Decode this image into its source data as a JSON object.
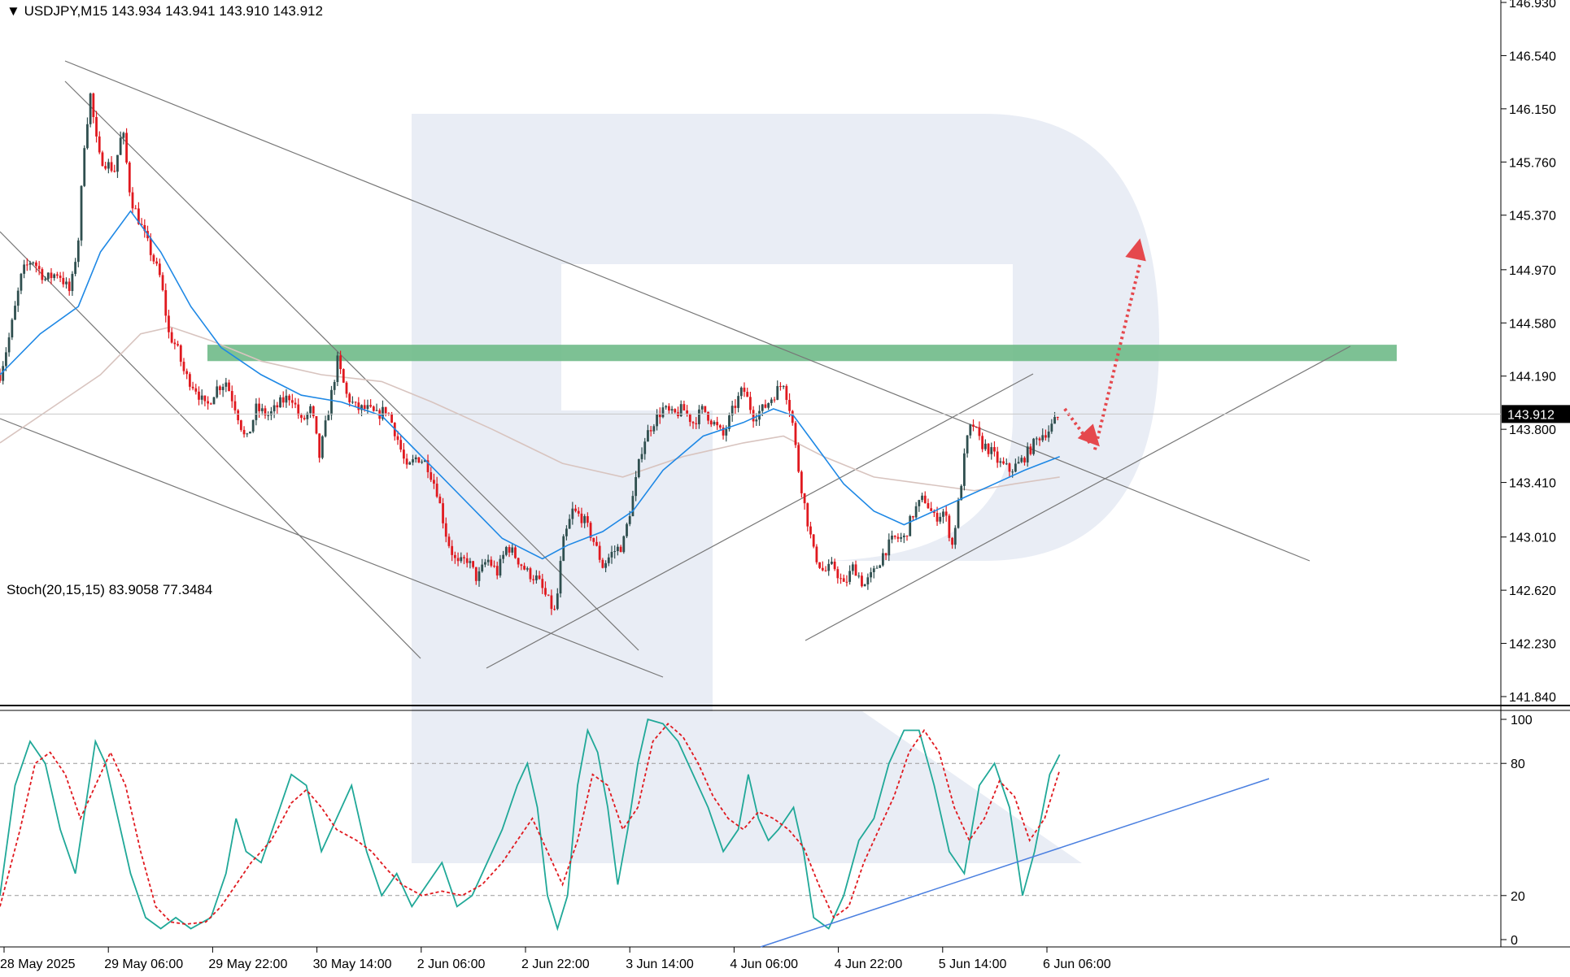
{
  "header": {
    "symbol": "USDJPY,M15",
    "ohlc": "143.934 143.941 143.910 143.912",
    "indicator": "Stoch(20,15,15) 83.9058 77.3484"
  },
  "price_axis": {
    "ticks": [
      "146.930",
      "146.540",
      "146.150",
      "145.760",
      "145.370",
      "144.970",
      "144.580",
      "144.190",
      "143.800",
      "143.410",
      "143.010",
      "142.620",
      "142.230",
      "141.840"
    ],
    "current_price": "143.912"
  },
  "stoch_axis": {
    "ticks": [
      "100",
      "80",
      "20",
      "0"
    ]
  },
  "time_axis": {
    "labels": [
      "28 May 2025",
      "29 May 06:00",
      "29 May 22:00",
      "30 May 14:00",
      "2 Jun 06:00",
      "2 Jun 22:00",
      "3 Jun 14:00",
      "4 Jun 06:00",
      "4 Jun 22:00",
      "5 Jun 14:00",
      "6 Jun 06:00"
    ]
  },
  "colors": {
    "bull": "#2f4f4f",
    "bear": "#e0191f",
    "ma_fast": "#1e88e5",
    "ma_slow": "#d8c4bf",
    "zone": "#6fba88",
    "arrow": "#e5484d",
    "stoch_main": "#20a898",
    "stoch_signal": "#e0191f",
    "trend": "#777777",
    "stoch_trend": "#4a7fe0"
  },
  "chart_data": [
    {
      "type": "candlestick",
      "symbol": "USDJPY",
      "timeframe": "M15",
      "ylim": [
        141.84,
        146.93
      ],
      "resistance_zone": [
        144.3,
        144.42
      ],
      "current_price": 143.912,
      "x_labels": [
        "28 May 2025",
        "29 May 06:00",
        "29 May 22:00",
        "30 May 14:00",
        "2 Jun 06:00",
        "2 Jun 22:00",
        "3 Jun 14:00",
        "4 Jun 06:00",
        "4 Jun 22:00",
        "5 Jun 14:00",
        "6 Jun 06:00"
      ],
      "path": [
        [
          0,
          144.2
        ],
        [
          10,
          144.5
        ],
        [
          22,
          144.95
        ],
        [
          32,
          145.05
        ],
        [
          45,
          144.9
        ],
        [
          58,
          144.95
        ],
        [
          70,
          144.8
        ],
        [
          78,
          145.2
        ],
        [
          84,
          145.9
        ],
        [
          90,
          146.25
        ],
        [
          98,
          145.8
        ],
        [
          106,
          145.75
        ],
        [
          114,
          145.7
        ],
        [
          122,
          146.0
        ],
        [
          130,
          145.5
        ],
        [
          140,
          145.3
        ],
        [
          150,
          145.1
        ],
        [
          160,
          144.9
        ],
        [
          168,
          144.5
        ],
        [
          176,
          144.4
        ],
        [
          184,
          144.2
        ],
        [
          195,
          144.1
        ],
        [
          205,
          143.95
        ],
        [
          215,
          144.1
        ],
        [
          225,
          144.15
        ],
        [
          235,
          143.95
        ],
        [
          245,
          143.7
        ],
        [
          255,
          143.95
        ],
        [
          268,
          143.9
        ],
        [
          280,
          144.0
        ],
        [
          290,
          144.05
        ],
        [
          300,
          143.85
        ],
        [
          310,
          143.95
        ],
        [
          318,
          143.6
        ],
        [
          326,
          143.9
        ],
        [
          336,
          144.3
        ],
        [
          345,
          144.05
        ],
        [
          355,
          143.95
        ],
        [
          365,
          143.95
        ],
        [
          375,
          143.9
        ],
        [
          385,
          143.95
        ],
        [
          395,
          143.75
        ],
        [
          405,
          143.5
        ],
        [
          415,
          143.6
        ],
        [
          425,
          143.55
        ],
        [
          435,
          143.35
        ],
        [
          445,
          143.0
        ],
        [
          455,
          142.8
        ],
        [
          465,
          142.85
        ],
        [
          475,
          142.7
        ],
        [
          485,
          142.85
        ],
        [
          495,
          142.75
        ],
        [
          505,
          142.95
        ],
        [
          515,
          142.85
        ],
        [
          525,
          142.75
        ],
        [
          535,
          142.7
        ],
        [
          545,
          142.55
        ],
        [
          553,
          142.45
        ],
        [
          560,
          142.95
        ],
        [
          570,
          143.2
        ],
        [
          580,
          143.15
        ],
        [
          590,
          143.0
        ],
        [
          600,
          142.8
        ],
        [
          610,
          142.9
        ],
        [
          620,
          142.95
        ],
        [
          630,
          143.3
        ],
        [
          640,
          143.7
        ],
        [
          650,
          143.85
        ],
        [
          660,
          143.95
        ],
        [
          670,
          143.9
        ],
        [
          680,
          143.95
        ],
        [
          690,
          143.85
        ],
        [
          700,
          143.95
        ],
        [
          710,
          143.85
        ],
        [
          720,
          143.75
        ],
        [
          730,
          143.95
        ],
        [
          740,
          144.1
        ],
        [
          750,
          143.9
        ],
        [
          760,
          143.95
        ],
        [
          770,
          144.05
        ],
        [
          780,
          144.15
        ],
        [
          788,
          143.9
        ],
        [
          794,
          143.55
        ],
        [
          802,
          143.2
        ],
        [
          810,
          142.9
        ],
        [
          820,
          142.75
        ],
        [
          830,
          142.8
        ],
        [
          840,
          142.65
        ],
        [
          850,
          142.8
        ],
        [
          860,
          142.65
        ],
        [
          870,
          142.75
        ],
        [
          880,
          142.9
        ],
        [
          890,
          143.0
        ],
        [
          900,
          143.0
        ],
        [
          910,
          143.2
        ],
        [
          920,
          143.3
        ],
        [
          930,
          143.15
        ],
        [
          940,
          143.2
        ],
        [
          948,
          142.95
        ],
        [
          955,
          143.3
        ],
        [
          962,
          143.7
        ],
        [
          968,
          143.85
        ],
        [
          976,
          143.7
        ],
        [
          985,
          143.65
        ],
        [
          995,
          143.55
        ],
        [
          1005,
          143.5
        ],
        [
          1015,
          143.55
        ],
        [
          1025,
          143.65
        ],
        [
          1035,
          143.75
        ],
        [
          1045,
          143.8
        ],
        [
          1055,
          143.91
        ]
      ],
      "ma_fast": [
        [
          0,
          144.2
        ],
        [
          40,
          144.5
        ],
        [
          78,
          144.7
        ],
        [
          100,
          145.1
        ],
        [
          130,
          145.4
        ],
        [
          160,
          145.1
        ],
        [
          190,
          144.7
        ],
        [
          220,
          144.4
        ],
        [
          260,
          144.2
        ],
        [
          300,
          144.05
        ],
        [
          340,
          144.0
        ],
        [
          380,
          143.9
        ],
        [
          420,
          143.6
        ],
        [
          460,
          143.3
        ],
        [
          500,
          143.0
        ],
        [
          540,
          142.85
        ],
        [
          565,
          142.95
        ],
        [
          600,
          143.05
        ],
        [
          630,
          143.2
        ],
        [
          660,
          143.5
        ],
        [
          700,
          143.75
        ],
        [
          740,
          143.85
        ],
        [
          770,
          143.95
        ],
        [
          790,
          143.9
        ],
        [
          810,
          143.7
        ],
        [
          840,
          143.4
        ],
        [
          870,
          143.2
        ],
        [
          900,
          143.1
        ],
        [
          930,
          143.2
        ],
        [
          960,
          143.3
        ],
        [
          990,
          143.4
        ],
        [
          1020,
          143.5
        ],
        [
          1055,
          143.6
        ]
      ],
      "ma_slow": [
        [
          0,
          143.7
        ],
        [
          50,
          143.95
        ],
        [
          100,
          144.2
        ],
        [
          140,
          144.5
        ],
        [
          170,
          144.55
        ],
        [
          210,
          144.45
        ],
        [
          260,
          144.3
        ],
        [
          320,
          144.2
        ],
        [
          380,
          144.15
        ],
        [
          430,
          144.0
        ],
        [
          490,
          143.8
        ],
        [
          560,
          143.55
        ],
        [
          620,
          143.45
        ],
        [
          680,
          143.6
        ],
        [
          740,
          143.7
        ],
        [
          780,
          143.75
        ],
        [
          820,
          143.6
        ],
        [
          870,
          143.45
        ],
        [
          920,
          143.4
        ],
        [
          970,
          143.35
        ],
        [
          1010,
          143.4
        ],
        [
          1055,
          143.45
        ]
      ],
      "forecast": [
        [
          1060,
          143.95
        ],
        [
          1090,
          143.65
        ],
        [
          1135,
          145.2
        ]
      ]
    },
    {
      "type": "line",
      "title": "Stoch(20,15,15)",
      "main": 83.9058,
      "signal": 77.3484,
      "levels": [
        80,
        20
      ],
      "ylim": [
        0,
        100
      ],
      "main_path": [
        [
          0,
          20
        ],
        [
          15,
          70
        ],
        [
          30,
          90
        ],
        [
          45,
          80
        ],
        [
          60,
          50
        ],
        [
          75,
          30
        ],
        [
          85,
          60
        ],
        [
          95,
          90
        ],
        [
          105,
          80
        ],
        [
          115,
          60
        ],
        [
          130,
          30
        ],
        [
          145,
          10
        ],
        [
          160,
          5
        ],
        [
          175,
          10
        ],
        [
          190,
          5
        ],
        [
          210,
          10
        ],
        [
          225,
          30
        ],
        [
          235,
          55
        ],
        [
          245,
          40
        ],
        [
          260,
          35
        ],
        [
          275,
          55
        ],
        [
          290,
          75
        ],
        [
          305,
          70
        ],
        [
          320,
          40
        ],
        [
          335,
          55
        ],
        [
          350,
          70
        ],
        [
          365,
          40
        ],
        [
          380,
          20
        ],
        [
          395,
          30
        ],
        [
          410,
          15
        ],
        [
          425,
          25
        ],
        [
          440,
          35
        ],
        [
          455,
          15
        ],
        [
          470,
          20
        ],
        [
          485,
          35
        ],
        [
          500,
          50
        ],
        [
          515,
          70
        ],
        [
          525,
          80
        ],
        [
          535,
          60
        ],
        [
          545,
          20
        ],
        [
          555,
          5
        ],
        [
          565,
          20
        ],
        [
          575,
          70
        ],
        [
          585,
          95
        ],
        [
          595,
          85
        ],
        [
          605,
          60
        ],
        [
          615,
          25
        ],
        [
          625,
          50
        ],
        [
          635,
          80
        ],
        [
          645,
          100
        ],
        [
          660,
          98
        ],
        [
          675,
          90
        ],
        [
          690,
          75
        ],
        [
          705,
          60
        ],
        [
          720,
          40
        ],
        [
          735,
          50
        ],
        [
          745,
          75
        ],
        [
          755,
          55
        ],
        [
          765,
          45
        ],
        [
          775,
          50
        ],
        [
          790,
          60
        ],
        [
          800,
          40
        ],
        [
          810,
          10
        ],
        [
          825,
          5
        ],
        [
          840,
          20
        ],
        [
          855,
          45
        ],
        [
          870,
          55
        ],
        [
          885,
          80
        ],
        [
          900,
          95
        ],
        [
          915,
          95
        ],
        [
          930,
          70
        ],
        [
          945,
          40
        ],
        [
          960,
          30
        ],
        [
          975,
          70
        ],
        [
          990,
          80
        ],
        [
          1005,
          60
        ],
        [
          1018,
          20
        ],
        [
          1030,
          40
        ],
        [
          1045,
          75
        ],
        [
          1055,
          84
        ]
      ],
      "signal_path": [
        [
          0,
          15
        ],
        [
          20,
          50
        ],
        [
          35,
          80
        ],
        [
          50,
          85
        ],
        [
          65,
          75
        ],
        [
          80,
          55
        ],
        [
          95,
          70
        ],
        [
          110,
          85
        ],
        [
          125,
          70
        ],
        [
          140,
          40
        ],
        [
          155,
          15
        ],
        [
          170,
          8
        ],
        [
          185,
          7
        ],
        [
          205,
          8
        ],
        [
          220,
          15
        ],
        [
          235,
          25
        ],
        [
          250,
          35
        ],
        [
          270,
          45
        ],
        [
          290,
          62
        ],
        [
          305,
          68
        ],
        [
          320,
          60
        ],
        [
          335,
          50
        ],
        [
          355,
          45
        ],
        [
          370,
          40
        ],
        [
          385,
          32
        ],
        [
          400,
          25
        ],
        [
          420,
          20
        ],
        [
          440,
          22
        ],
        [
          460,
          20
        ],
        [
          480,
          25
        ],
        [
          500,
          35
        ],
        [
          515,
          45
        ],
        [
          530,
          55
        ],
        [
          545,
          40
        ],
        [
          560,
          25
        ],
        [
          575,
          45
        ],
        [
          590,
          75
        ],
        [
          605,
          70
        ],
        [
          620,
          50
        ],
        [
          635,
          60
        ],
        [
          650,
          90
        ],
        [
          665,
          98
        ],
        [
          680,
          92
        ],
        [
          695,
          80
        ],
        [
          710,
          65
        ],
        [
          725,
          55
        ],
        [
          740,
          50
        ],
        [
          755,
          58
        ],
        [
          770,
          55
        ],
        [
          785,
          50
        ],
        [
          800,
          42
        ],
        [
          815,
          25
        ],
        [
          830,
          10
        ],
        [
          845,
          15
        ],
        [
          860,
          35
        ],
        [
          875,
          50
        ],
        [
          890,
          65
        ],
        [
          905,
          85
        ],
        [
          920,
          95
        ],
        [
          935,
          85
        ],
        [
          950,
          60
        ],
        [
          965,
          45
        ],
        [
          980,
          55
        ],
        [
          995,
          72
        ],
        [
          1010,
          65
        ],
        [
          1025,
          45
        ],
        [
          1040,
          55
        ],
        [
          1055,
          77
        ]
      ]
    }
  ]
}
